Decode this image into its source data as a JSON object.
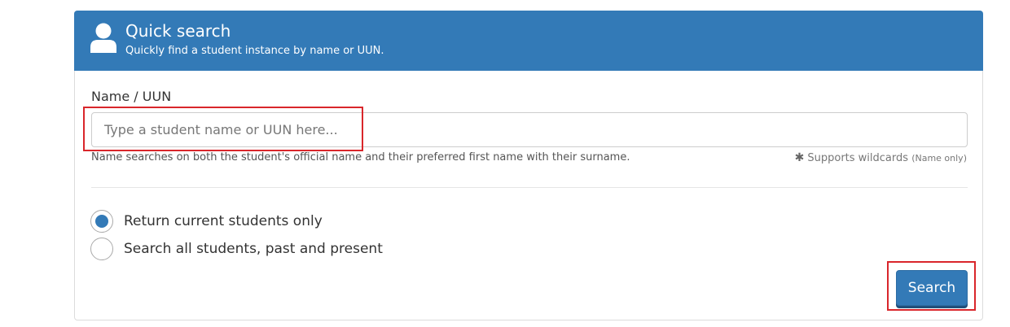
{
  "header": {
    "title": "Quick search",
    "subtitle": "Quickly find a student instance by name or UUN.",
    "icon": "user-icon",
    "background_color": "#337ab7"
  },
  "form": {
    "name_label": "Name / UUN",
    "input_placeholder": "Type a student name or UUN here...",
    "input_value": "",
    "help_text": "Name searches on both the student's official name and their preferred first name with their surname.",
    "wildcard_icon": "asterisk-icon",
    "wildcard_text": "Supports wildcards",
    "wildcard_note": "(Name only)"
  },
  "radios": [
    {
      "label": "Return current students only",
      "checked": true
    },
    {
      "label": "Search all students, past and present",
      "checked": false
    }
  ],
  "search_button": {
    "label": "Search"
  },
  "highlight_color": "#d9262b"
}
